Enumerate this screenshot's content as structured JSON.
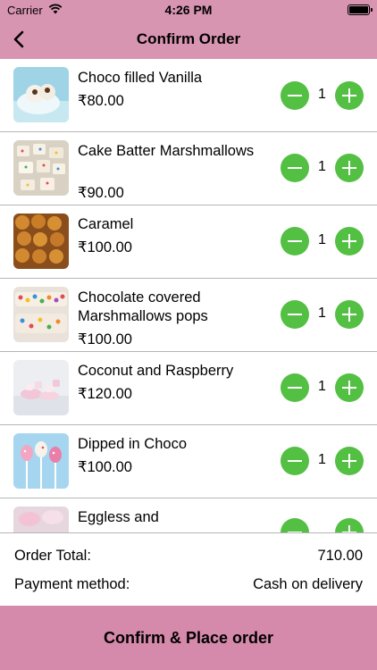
{
  "status_bar": {
    "carrier": "Carrier",
    "time": "4:26 PM"
  },
  "nav": {
    "title": "Confirm Order"
  },
  "items": [
    {
      "name": "Choco filled Vanilla",
      "price": "₹80.00",
      "quantity": "1"
    },
    {
      "name": "Cake Batter Marshmallows",
      "price": "₹90.00",
      "quantity": "1"
    },
    {
      "name": "Caramel",
      "price": "₹100.00",
      "quantity": "1"
    },
    {
      "name": "Chocolate covered Marshmallows pops",
      "price": "₹100.00",
      "quantity": "1"
    },
    {
      "name": "Coconut and Raspberry",
      "price": "₹120.00",
      "quantity": "1"
    },
    {
      "name": "Dipped in Choco",
      "price": "₹100.00",
      "quantity": "1"
    },
    {
      "name": "Eggless and",
      "price": "",
      "quantity": ""
    }
  ],
  "summary": {
    "total_label": "Order Total:",
    "total_value": "710.00",
    "payment_label": "Payment method:",
    "payment_value": "Cash on delivery"
  },
  "confirm_label": "Confirm & Place order",
  "colors": {
    "header": "#d895b1",
    "button_bar": "#d68aab",
    "stepper": "#53c043"
  }
}
